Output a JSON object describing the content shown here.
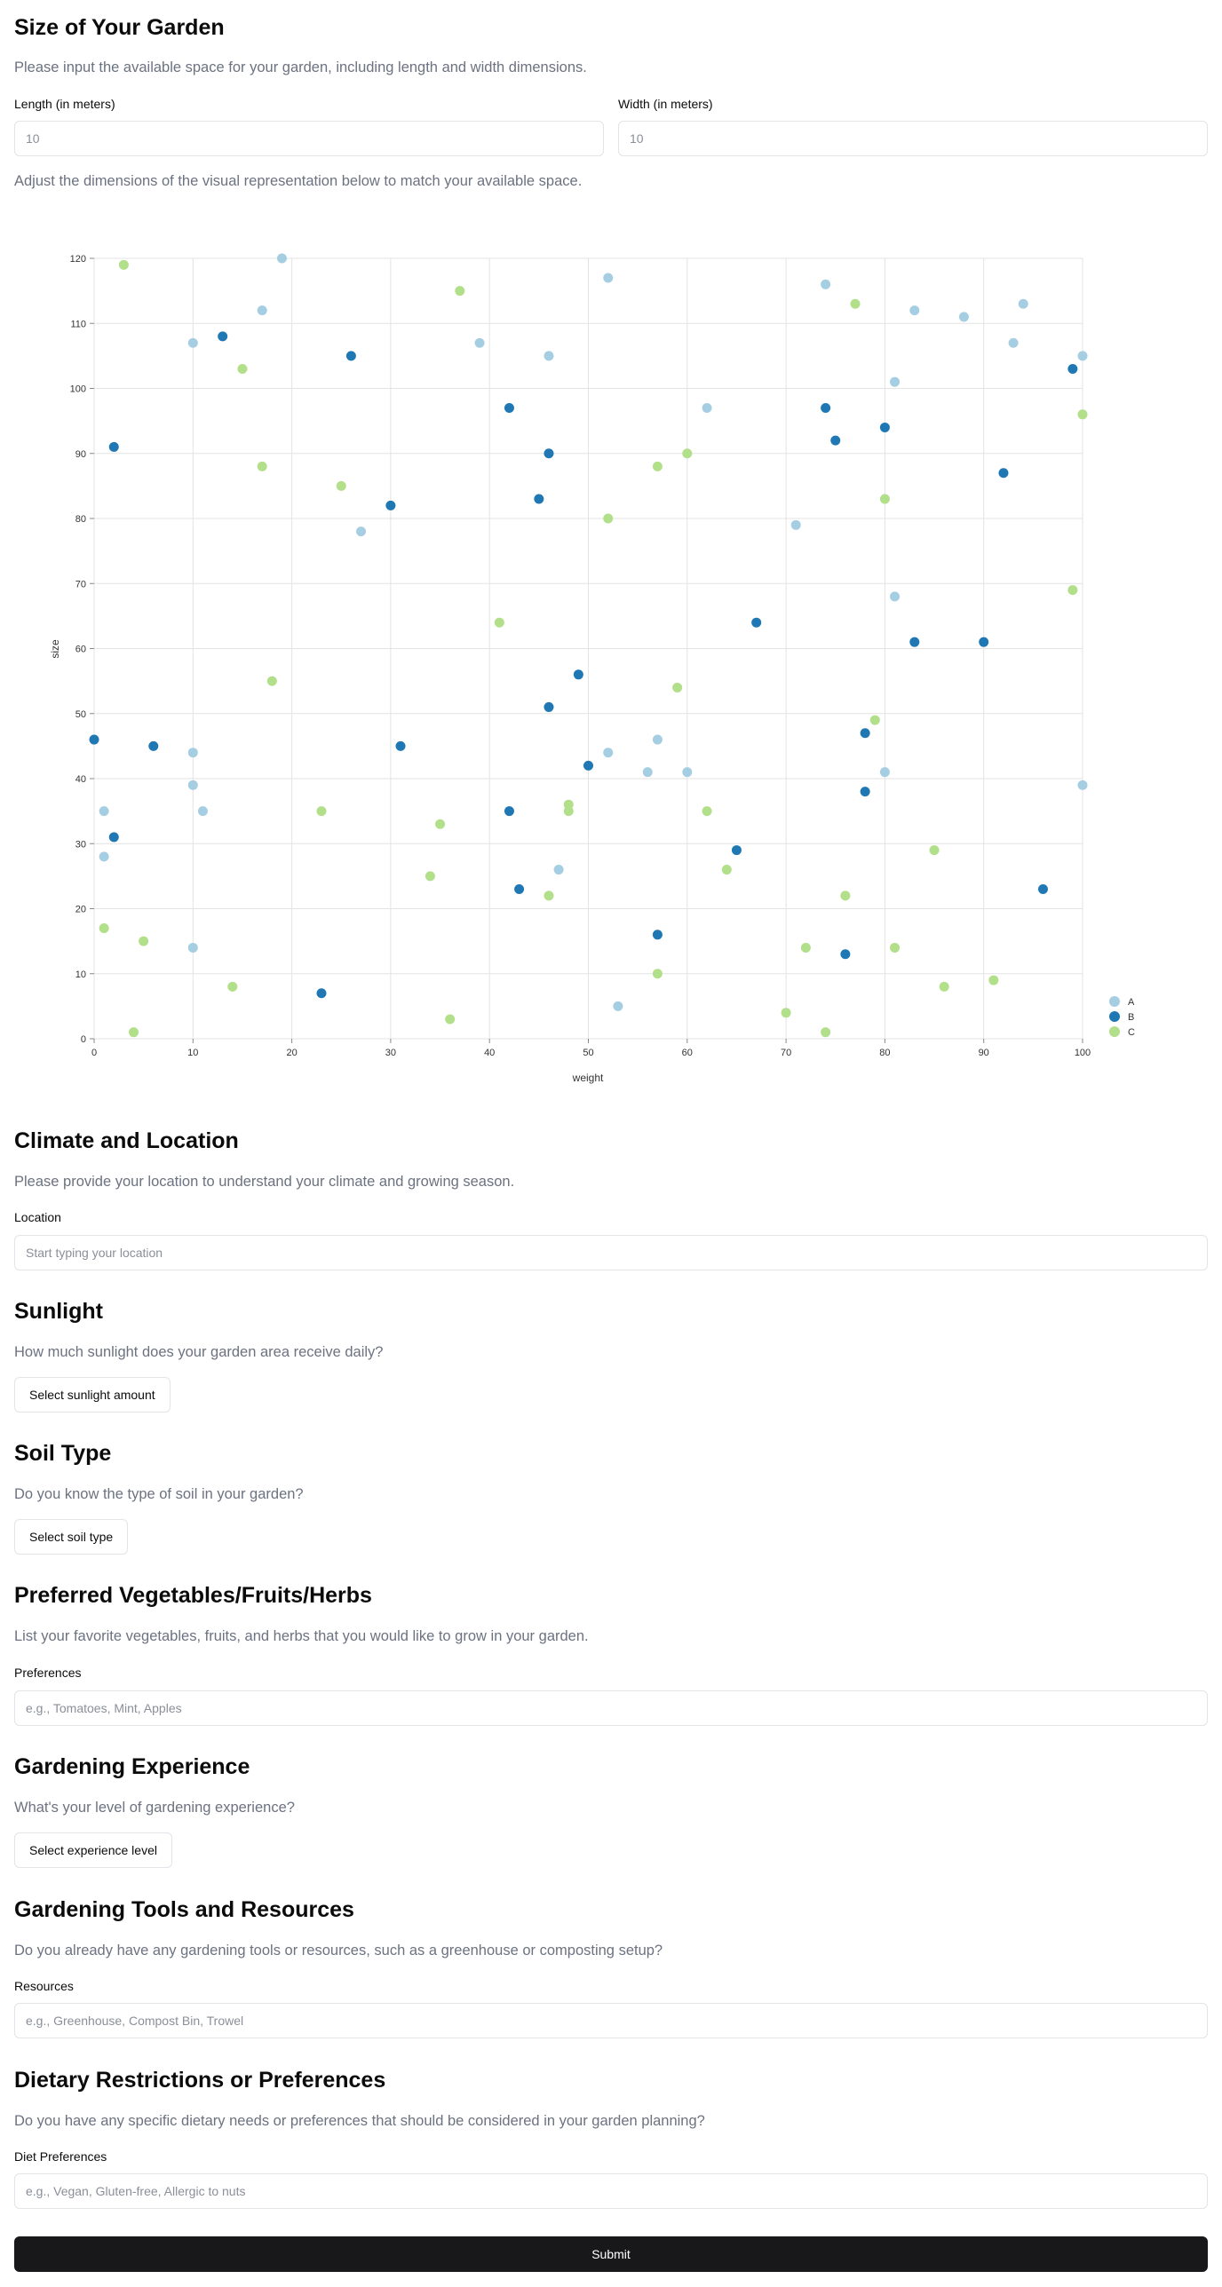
{
  "garden_size": {
    "title": "Size of Your Garden",
    "description": "Please input the available space for your garden, including length and width dimensions.",
    "length_label": "Length (in meters)",
    "length_placeholder": "10",
    "width_label": "Width (in meters)",
    "width_placeholder": "10",
    "adjust_note": "Adjust the dimensions of the visual representation below to match your available space."
  },
  "chart_data": {
    "type": "scatter",
    "xlabel": "weight",
    "ylabel": "size",
    "xlim": [
      0,
      100
    ],
    "ylim": [
      0,
      120
    ],
    "x_ticks": [
      "0",
      "10",
      "20",
      "30",
      "40",
      "50",
      "60",
      "70",
      "80",
      "90",
      "100"
    ],
    "y_ticks": [
      "0",
      "10",
      "20",
      "30",
      "40",
      "50",
      "60",
      "70",
      "80",
      "90",
      "100",
      "110",
      "120"
    ],
    "grid": true,
    "legend_position": "bottom-right",
    "series": [
      {
        "name": "A",
        "color": "#a6cee3",
        "points": [
          [
            1,
            35
          ],
          [
            1,
            28
          ],
          [
            10,
            107
          ],
          [
            10,
            44
          ],
          [
            10,
            39
          ],
          [
            10,
            14
          ],
          [
            11,
            35
          ],
          [
            17,
            112
          ],
          [
            19,
            120
          ],
          [
            27,
            78
          ],
          [
            39,
            107
          ],
          [
            46,
            105
          ],
          [
            47,
            26
          ],
          [
            52,
            117
          ],
          [
            52,
            44
          ],
          [
            53,
            5
          ],
          [
            56,
            41
          ],
          [
            57,
            46
          ],
          [
            60,
            41
          ],
          [
            62,
            97
          ],
          [
            71,
            79
          ],
          [
            74,
            116
          ],
          [
            80,
            41
          ],
          [
            81,
            101
          ],
          [
            81,
            68
          ],
          [
            83,
            112
          ],
          [
            88,
            111
          ],
          [
            93,
            107
          ],
          [
            94,
            113
          ],
          [
            100,
            105
          ],
          [
            100,
            39
          ]
        ]
      },
      {
        "name": "B",
        "color": "#1f78b4",
        "points": [
          [
            0,
            46
          ],
          [
            2,
            91
          ],
          [
            2,
            31
          ],
          [
            6,
            45
          ],
          [
            13,
            108
          ],
          [
            23,
            7
          ],
          [
            26,
            105
          ],
          [
            30,
            82
          ],
          [
            31,
            45
          ],
          [
            42,
            97
          ],
          [
            42,
            35
          ],
          [
            43,
            23
          ],
          [
            45,
            83
          ],
          [
            46,
            90
          ],
          [
            46,
            51
          ],
          [
            49,
            56
          ],
          [
            50,
            42
          ],
          [
            57,
            16
          ],
          [
            65,
            29
          ],
          [
            67,
            64
          ],
          [
            74,
            97
          ],
          [
            75,
            92
          ],
          [
            76,
            13
          ],
          [
            78,
            47
          ],
          [
            78,
            38
          ],
          [
            80,
            94
          ],
          [
            83,
            61
          ],
          [
            90,
            61
          ],
          [
            92,
            87
          ],
          [
            96,
            23
          ],
          [
            99,
            103
          ]
        ]
      },
      {
        "name": "C",
        "color": "#b2df8a",
        "points": [
          [
            1,
            17
          ],
          [
            3,
            119
          ],
          [
            4,
            1
          ],
          [
            5,
            15
          ],
          [
            14,
            8
          ],
          [
            15,
            103
          ],
          [
            17,
            88
          ],
          [
            18,
            55
          ],
          [
            23,
            35
          ],
          [
            25,
            85
          ],
          [
            34,
            25
          ],
          [
            35,
            33
          ],
          [
            36,
            3
          ],
          [
            37,
            115
          ],
          [
            41,
            64
          ],
          [
            46,
            22
          ],
          [
            48,
            36
          ],
          [
            48,
            35
          ],
          [
            52,
            80
          ],
          [
            57,
            88
          ],
          [
            57,
            10
          ],
          [
            59,
            54
          ],
          [
            60,
            90
          ],
          [
            62,
            35
          ],
          [
            64,
            26
          ],
          [
            70,
            4
          ],
          [
            72,
            14
          ],
          [
            74,
            1
          ],
          [
            76,
            22
          ],
          [
            77,
            113
          ],
          [
            79,
            49
          ],
          [
            80,
            83
          ],
          [
            81,
            14
          ],
          [
            85,
            29
          ],
          [
            86,
            8
          ],
          [
            91,
            9
          ],
          [
            99,
            69
          ],
          [
            100,
            96
          ]
        ]
      }
    ]
  },
  "climate": {
    "title": "Climate and Location",
    "description": "Please provide your location to understand your climate and growing season.",
    "location_label": "Location",
    "location_placeholder": "Start typing your location"
  },
  "sunlight": {
    "title": "Sunlight",
    "description": "How much sunlight does your garden area receive daily?",
    "button": "Select sunlight amount"
  },
  "soil": {
    "title": "Soil Type",
    "description": "Do you know the type of soil in your garden?",
    "button": "Select soil type"
  },
  "preferences": {
    "title": "Preferred Vegetables/Fruits/Herbs",
    "description": "List your favorite vegetables, fruits, and herbs that you would like to grow in your garden.",
    "label": "Preferences",
    "placeholder": "e.g., Tomatoes, Mint, Apples"
  },
  "experience": {
    "title": "Gardening Experience",
    "description": "What's your level of gardening experience?",
    "button": "Select experience level"
  },
  "tools": {
    "title": "Gardening Tools and Resources",
    "description": "Do you already have any gardening tools or resources, such as a greenhouse or composting setup?",
    "label": "Resources",
    "placeholder": "e.g., Greenhouse, Compost Bin, Trowel"
  },
  "diet": {
    "title": "Dietary Restrictions or Preferences",
    "description": "Do you have any specific dietary needs or preferences that should be considered in your garden planning?",
    "label": "Diet Preferences",
    "placeholder": "e.g., Vegan, Gluten-free, Allergic to nuts"
  },
  "submit_label": "Submit"
}
